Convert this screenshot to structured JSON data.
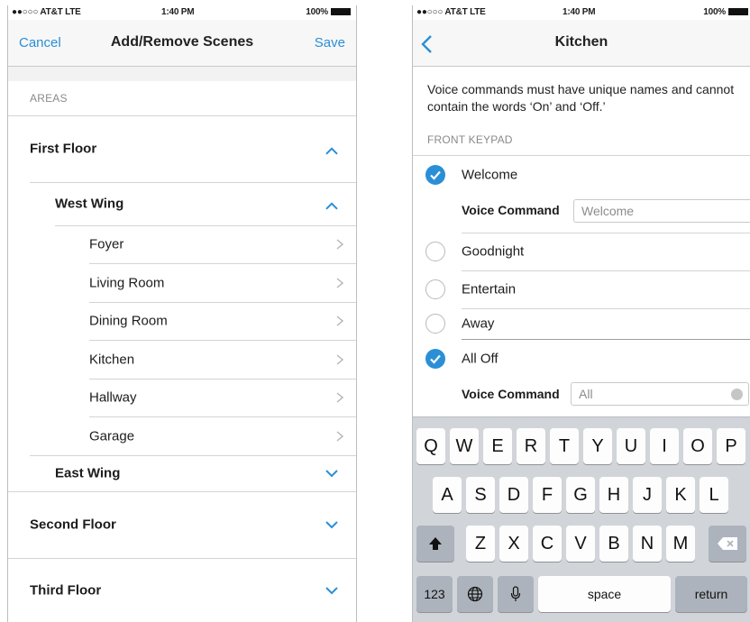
{
  "left_screen": {
    "status": {
      "carrier": "●●○○○ AT&T  LTE",
      "time": "1:40 PM",
      "battery": "100%"
    },
    "nav": {
      "cancel": "Cancel",
      "title": "Add/Remove Scenes",
      "save": "Save"
    },
    "section_label": "AREAS",
    "areas": {
      "first_floor": "First Floor",
      "west_wing": "West Wing",
      "rooms": [
        "Foyer",
        "Living Room",
        "Dining Room",
        "Kitchen",
        "Hallway",
        "Garage"
      ],
      "east_wing": "East Wing",
      "second_floor": "Second Floor",
      "third_floor": "Third Floor"
    }
  },
  "right_screen": {
    "status": {
      "carrier": "●●○○○ AT&T  LTE",
      "time": "1:40 PM",
      "battery": "100%"
    },
    "nav": {
      "title": "Kitchen",
      "back_icon": "chevron-left-icon"
    },
    "info": "Voice commands must have unique names and cannot contain the words ‘On’ and ‘Off.’",
    "keypad_label": "FRONT KEYPAD",
    "scenes": [
      {
        "name": "Welcome",
        "selected": true
      },
      {
        "name": "Goodnight",
        "selected": false
      },
      {
        "name": "Entertain",
        "selected": false
      },
      {
        "name": "Away",
        "selected": false
      },
      {
        "name": "All Off",
        "selected": true
      }
    ],
    "voice_command_label": "Voice Command",
    "voice_welcome_value": "Welcome",
    "voice_alloff_value": "All",
    "keyboard": {
      "row1": [
        "Q",
        "W",
        "E",
        "R",
        "T",
        "Y",
        "U",
        "I",
        "O",
        "P"
      ],
      "row2": [
        "A",
        "S",
        "D",
        "F",
        "G",
        "H",
        "J",
        "K",
        "L"
      ],
      "row3": [
        "Z",
        "X",
        "C",
        "V",
        "B",
        "N",
        "M"
      ],
      "numbers": "123",
      "space": "space",
      "return": "return"
    },
    "accent_color": "#2a8fd6"
  }
}
